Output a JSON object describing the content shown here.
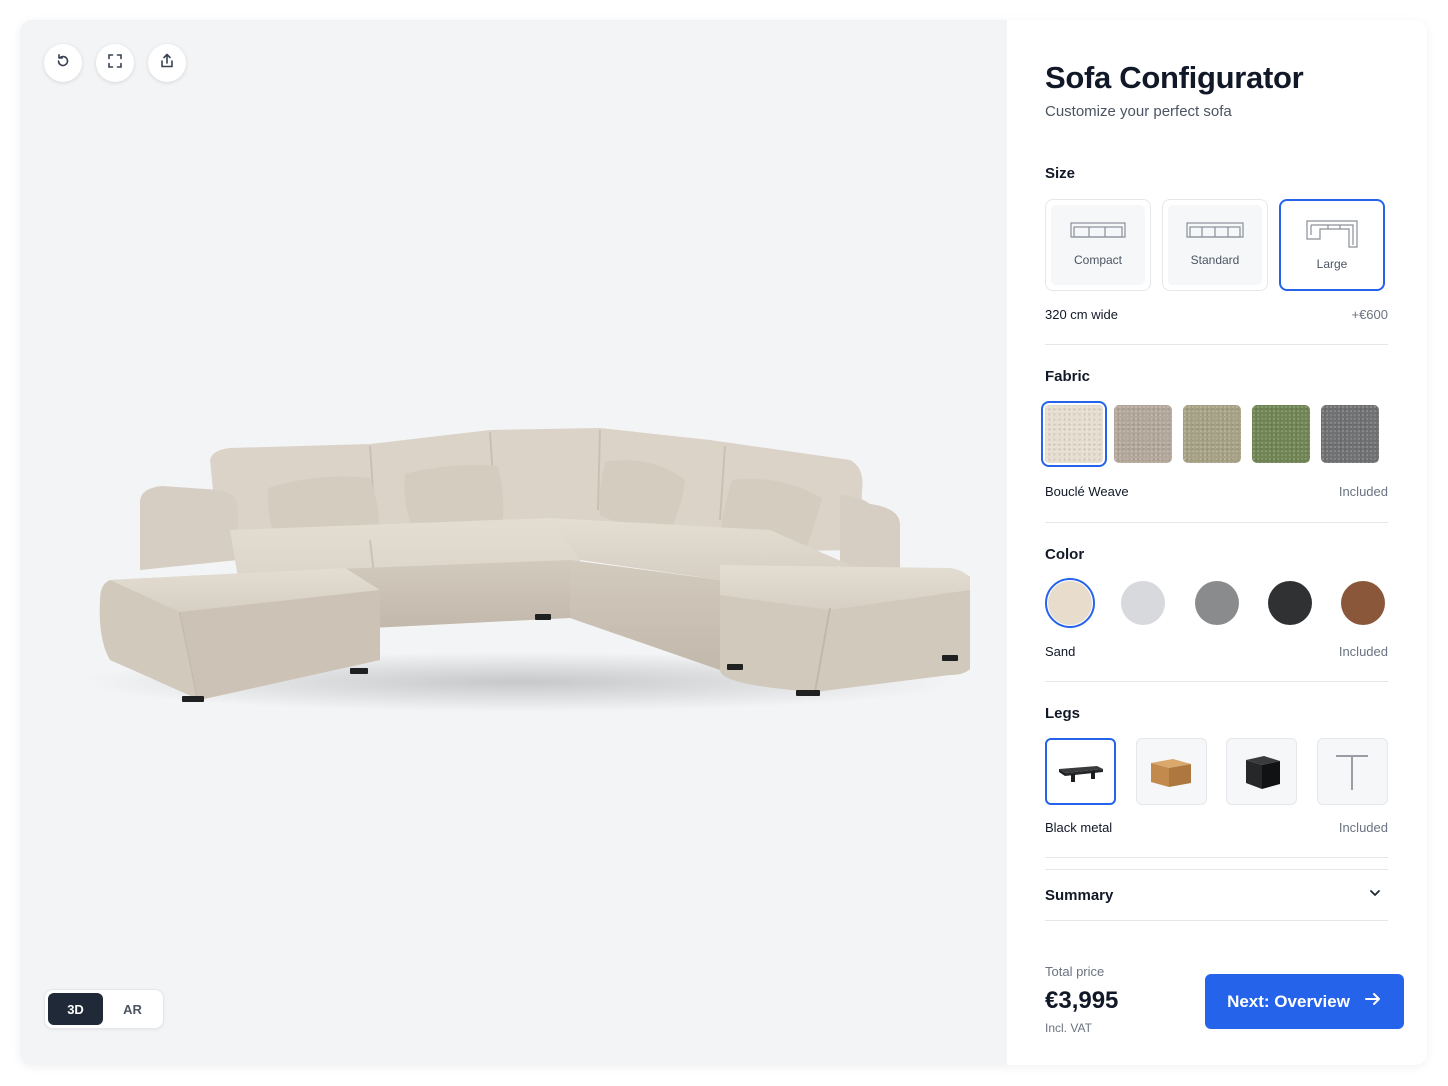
{
  "viewer": {
    "toolbar": [
      {
        "name": "reset-view-button",
        "icon": "rotate-icon"
      },
      {
        "name": "fullscreen-button",
        "icon": "expand-icon"
      },
      {
        "name": "share-button",
        "icon": "share-icon"
      }
    ],
    "modes": [
      "3D",
      "AR"
    ],
    "active_mode": "3D"
  },
  "panel": {
    "title": "Sofa Configurator",
    "subtitle": "Customize your perfect sofa",
    "size": {
      "title": "Size",
      "options": [
        "Compact",
        "Standard",
        "Large"
      ],
      "selected": "Large",
      "detail": "320 cm wide",
      "price": "+€600"
    },
    "fabric": {
      "title": "Fabric",
      "swatch_colors": [
        "#e6ddd0",
        "#b3a79b",
        "#a6a184",
        "#6f8452",
        "#6e7071"
      ],
      "selected_name": "Bouclé Weave",
      "price": "Included"
    },
    "color": {
      "title": "Color",
      "swatch_colors": [
        "#e8dccd",
        "#d7d9dc",
        "#898b8d",
        "#303133",
        "#8b573a"
      ],
      "selected_name": "Sand",
      "price": "Included"
    },
    "legs": {
      "title": "Legs",
      "options": [
        "black-metal-leg-icon",
        "oak-block-leg-icon",
        "black-block-leg-icon",
        "t-leg-icon"
      ],
      "selected_name": "Black metal",
      "price": "Included"
    },
    "summary": {
      "title": "Summary"
    },
    "total": {
      "label": "Total price",
      "price": "€3,995",
      "vat": "Incl. VAT"
    },
    "next_button": "Next: Overview"
  }
}
